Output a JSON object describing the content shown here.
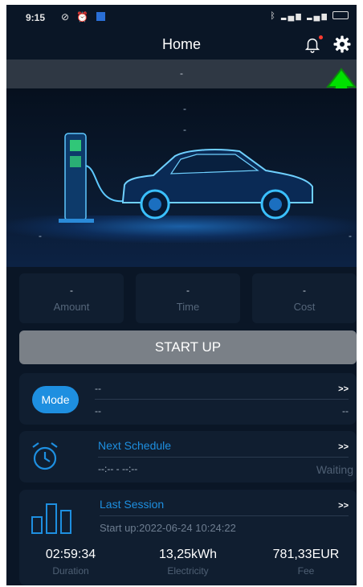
{
  "status_bar": {
    "time": "9:15",
    "left_icons": [
      "no-signal-icon",
      "alarm-icon",
      "app-badge-icon"
    ],
    "right_icons": [
      "bluetooth-icon",
      "signal-icon",
      "signal-icon",
      "battery-icon"
    ]
  },
  "header": {
    "title": "Home",
    "notification_dot_color": "#ff3b30"
  },
  "info_strip": {
    "text": "-"
  },
  "hero": {
    "line1": "-",
    "line2": "-",
    "left_value": "-",
    "right_value": "-"
  },
  "stats": [
    {
      "value": "-",
      "label": "Amount"
    },
    {
      "value": "-",
      "label": "Time"
    },
    {
      "value": "-",
      "label": "Cost"
    }
  ],
  "start_button": {
    "label": "START UP",
    "color": "#7a8087"
  },
  "mode_card": {
    "pill_label": "Mode",
    "line1": "--",
    "line2": "--",
    "chevron": ">>",
    "right_value": "--",
    "accent_color": "#1e8fe0"
  },
  "schedule_card": {
    "title": "Next Schedule",
    "time_range": "--:-- - --:--",
    "status": "Waiting",
    "chevron": ">>"
  },
  "session_card": {
    "title": "Last Session",
    "start_text": "Start up:2022-06-24 10:24:22",
    "chevron": ">>",
    "metrics": [
      {
        "value": "02:59:34",
        "label": "Duration"
      },
      {
        "value": "13,25kWh",
        "label": "Electricity"
      },
      {
        "value": "781,33EUR",
        "label": "Fee"
      }
    ]
  },
  "annotation": {
    "arrow_color": "#00e000"
  }
}
